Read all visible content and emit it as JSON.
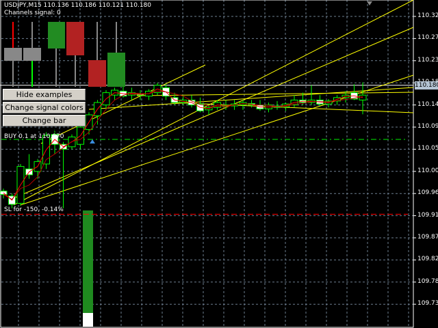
{
  "header": {
    "symbol_line": "USDJPY,M15  110.136 110.186 110.121 110.180",
    "channels_signal": "Channels signal: 0"
  },
  "buttons": {
    "hide_examples": "Hide examples",
    "change_signal_colors": "Change signal colors",
    "change_bar_thickness": "Change bar thickness"
  },
  "labels": {
    "buy": "BUY 0.1 at 110.070",
    "sl": "SL for -150, -0.14%"
  },
  "price_axis": [
    "110.320",
    "110.275",
    "110.230",
    "110.185",
    "110.140",
    "110.095",
    "110.050",
    "110.005",
    "109.960",
    "109.915",
    "109.870",
    "109.825",
    "109.780",
    "109.735"
  ],
  "current_price": "110.180",
  "colors": {
    "bull": "#00ff00",
    "bear_fill": "#ffffff",
    "grid": "#6e7f91",
    "ma_fast": "#ff0000",
    "ma_slow": "#b00000",
    "channel": "#ffff00",
    "buy_line": "#00a000",
    "sl_line": "#ff0000",
    "volume": "#1f8a1f"
  },
  "candles": [
    [
      109.965,
      109.97,
      109.95,
      109.958
    ],
    [
      109.955,
      109.96,
      109.93,
      109.938
    ],
    [
      109.94,
      110.02,
      109.935,
      110.015
    ],
    [
      110.01,
      110.04,
      109.99,
      109.998
    ],
    [
      110.005,
      110.03,
      109.99,
      110.025
    ],
    [
      110.02,
      110.085,
      110.01,
      110.078
    ],
    [
      110.08,
      110.09,
      110.04,
      110.06
    ],
    [
      110.06,
      110.065,
      109.93,
      110.05
    ],
    [
      110.055,
      110.08,
      110.05,
      110.075
    ],
    [
      110.06,
      110.1,
      110.05,
      110.095
    ],
    [
      110.09,
      110.125,
      110.08,
      110.12
    ],
    [
      110.118,
      110.15,
      110.1,
      110.145
    ],
    [
      110.14,
      110.17,
      110.13,
      110.165
    ],
    [
      110.16,
      110.175,
      110.15,
      110.17
    ],
    [
      110.168,
      110.18,
      110.155,
      110.158
    ],
    [
      110.16,
      110.175,
      110.15,
      110.165
    ],
    [
      110.163,
      110.17,
      110.15,
      110.16
    ],
    [
      110.158,
      110.172,
      110.15,
      110.168
    ],
    [
      110.165,
      110.185,
      110.16,
      110.18
    ],
    [
      110.175,
      110.182,
      110.15,
      110.158
    ],
    [
      110.155,
      110.165,
      110.14,
      110.145
    ],
    [
      110.145,
      110.16,
      110.14,
      110.15
    ],
    [
      110.15,
      110.16,
      110.135,
      110.14
    ],
    [
      110.142,
      110.155,
      110.125,
      110.128
    ],
    [
      110.13,
      110.14,
      110.12,
      110.135
    ],
    [
      110.135,
      110.15,
      110.13,
      110.145
    ],
    [
      110.14,
      110.15,
      110.13,
      110.138
    ],
    [
      110.138,
      110.15,
      110.13,
      110.142
    ],
    [
      110.14,
      110.15,
      110.13,
      110.145
    ],
    [
      110.143,
      110.15,
      110.135,
      110.14
    ],
    [
      110.14,
      110.15,
      110.128,
      110.132
    ],
    [
      110.132,
      110.145,
      110.125,
      110.14
    ],
    [
      110.138,
      110.148,
      110.13,
      110.135
    ],
    [
      110.136,
      110.145,
      110.128,
      110.142
    ],
    [
      110.14,
      110.16,
      110.135,
      110.15
    ],
    [
      110.15,
      110.165,
      110.14,
      110.145
    ],
    [
      110.145,
      110.18,
      110.14,
      110.15
    ],
    [
      110.15,
      110.16,
      110.138,
      110.142
    ],
    [
      110.142,
      110.152,
      110.135,
      110.148
    ],
    [
      110.148,
      110.16,
      110.14,
      110.155
    ],
    [
      110.155,
      110.168,
      110.145,
      110.16
    ],
    [
      110.165,
      110.182,
      110.15,
      110.152
    ],
    [
      110.15,
      110.186,
      110.121,
      110.16
    ]
  ],
  "volume_signal": {
    "fill_fraction": 0.88
  }
}
